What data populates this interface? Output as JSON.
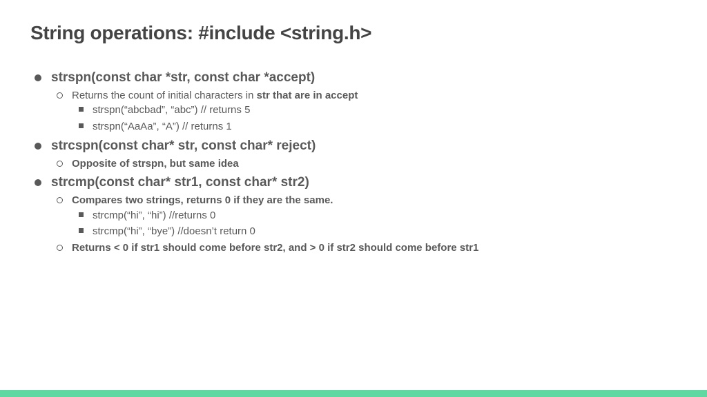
{
  "title": "String operations: #include <string.h>",
  "items": [
    {
      "text": "strspn(const char *str, const char *accept)",
      "sub": [
        {
          "prefix": "Returns the count of initial characters in ",
          "bold": "str that are in accept",
          "sub": [
            {
              "text": "strspn(“abcbad”, “abc”) // returns 5"
            },
            {
              "text": "strspn(“AaAa”, “A”) // returns 1"
            }
          ]
        }
      ]
    },
    {
      "text": "strcspn(const char* str, const char* reject)",
      "sub": [
        {
          "prefix": "Opposite of strspn, but same idea",
          "bold": ""
        }
      ]
    },
    {
      "text": "strcmp(const char* str1, const char* str2)",
      "sub": [
        {
          "prefix": "Compares two strings, returns 0 if they are the same.",
          "bold": "",
          "sub": [
            {
              "text": "strcmp(“hi”, “hi”) //returns 0"
            },
            {
              "text": "strcmp(“hi”, “bye”) //doesn’t return 0"
            }
          ]
        },
        {
          "prefix": "Returns < 0 if str1 should come before str2, and > 0  if str2 should come before str1",
          "bold": ""
        }
      ]
    }
  ]
}
